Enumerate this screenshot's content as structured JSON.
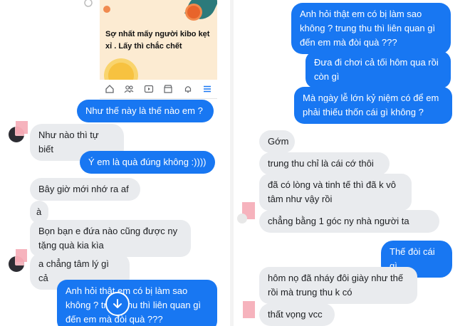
{
  "left": {
    "post_card": {
      "text": "Sợ nhất mấy người kibo kẹt xỉ . Lấy thì chắc chết"
    },
    "messages": [
      {
        "side": "out",
        "text": "Như thế này là thế nào em ?"
      },
      {
        "side": "in",
        "text": "Như nào thì tự biết"
      },
      {
        "side": "out",
        "text": "Ý em là quà đúng không :))))"
      },
      {
        "side": "in",
        "text": "Bây giờ mới nhớ ra af"
      },
      {
        "side": "in",
        "text": "à"
      },
      {
        "side": "in",
        "text": "Bọn bạn e đứa nào cũng được ny tặng quà kia kìa"
      },
      {
        "side": "in",
        "text": "a chẳng tâm lý gì cả"
      },
      {
        "side": "out",
        "text": "Anh hỏi thật em có bị làm sao không ? trung thu thì liên quan gì đến em mà đòi quà ???"
      }
    ]
  },
  "right": {
    "messages": [
      {
        "side": "out",
        "text": "Anh hỏi thật em có bị làm sao không ? trung thu thì liên quan gì đến em mà đòi quà ???"
      },
      {
        "side": "out",
        "text": "Đưa đi chơi cả tối hôm qua rồi còn gì"
      },
      {
        "side": "out",
        "text": "Mà ngày lễ lớn kỷ niệm có để em phải thiếu thốn cái gì không ?"
      },
      {
        "side": "in",
        "text": "Gớm"
      },
      {
        "side": "in",
        "text": "trung thu chỉ là cái cớ thôi"
      },
      {
        "side": "in",
        "text": "đã có lòng và tinh tế thì đã k vô tâm như vậy rồi"
      },
      {
        "side": "in",
        "text": "chẳng bằng 1 góc ny nhà người ta"
      },
      {
        "side": "out",
        "text": "Thế đòi cái gì"
      },
      {
        "side": "in",
        "text": "hôm nọ đã nháy đôi giày như thế rồi mà trung thu k có"
      },
      {
        "side": "in",
        "text": "thất vọng vcc"
      }
    ]
  },
  "colors": {
    "outgoing_bubble": "#1877f2",
    "incoming_bubble": "#e9ebee",
    "avatar_blur": "#f4a6b1"
  },
  "icons": [
    "home-icon",
    "friends-icon",
    "video-icon",
    "marketplace-icon",
    "bell-icon",
    "menu-icon",
    "arrow-down-icon"
  ]
}
